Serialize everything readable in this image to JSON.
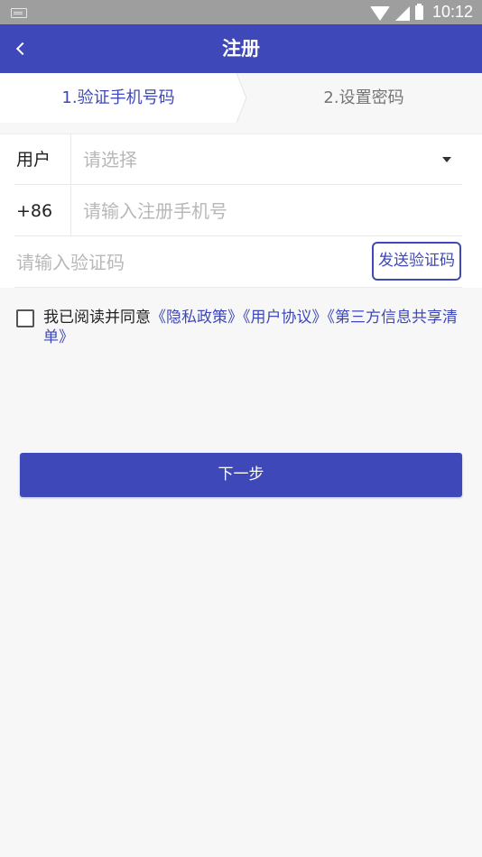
{
  "status_bar": {
    "time": "10:12"
  },
  "app_bar": {
    "title": "注册"
  },
  "steps": [
    {
      "label": "1.验证手机号码",
      "active": true
    },
    {
      "label": "2.设置密码",
      "active": false
    }
  ],
  "form": {
    "user_label": "用户",
    "user_select_placeholder": "请选择",
    "country_code": "+86",
    "phone_placeholder": "请输入注册手机号",
    "code_placeholder": "请输入验证码",
    "send_code_label": "发送验证码"
  },
  "agreement": {
    "prefix": "我已阅读并同意",
    "privacy": "《隐私政策》",
    "user_agreement": "《用户协议》",
    "third_party": "《第三方信息共享清单》",
    "checked": false
  },
  "next_button": {
    "label": "下一步"
  },
  "colors": {
    "primary": "#3f48b9",
    "status_bar": "#9e9e9e",
    "background": "#f7f7f7"
  }
}
